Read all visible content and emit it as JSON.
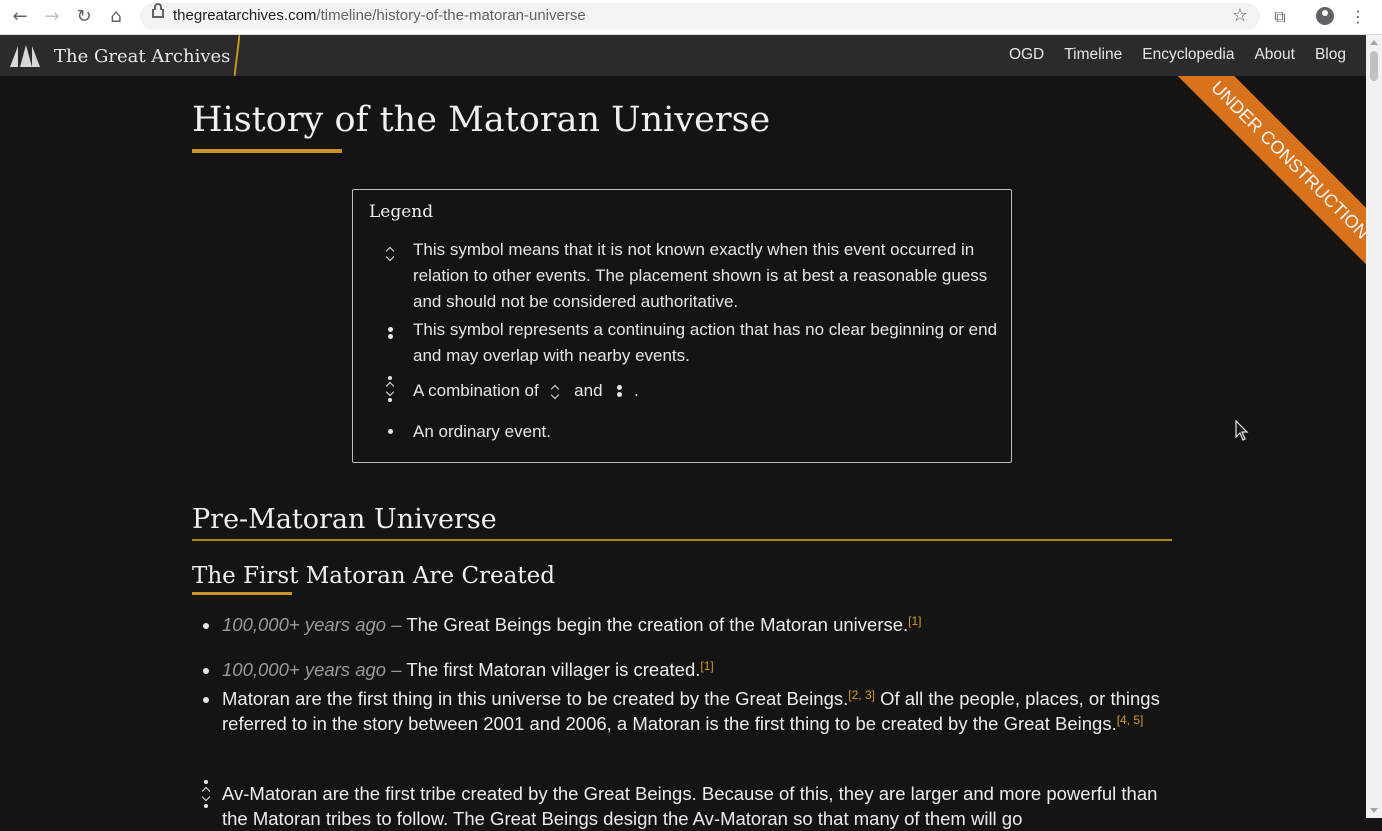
{
  "browser": {
    "url_domain": "thegreatarchives.com",
    "url_path": "/timeline/history-of-the-matoran-universe"
  },
  "site": {
    "brand": "The Great Archives",
    "nav": [
      "OGD",
      "Timeline",
      "Encyclopedia",
      "About",
      "Blog"
    ]
  },
  "ribbon": "UNDER CONSTRUCTION",
  "page": {
    "title": "History of the Matoran Universe"
  },
  "legend": {
    "title": "Legend",
    "items": [
      {
        "symbol": "uncertain-placement-icon",
        "text": "This symbol means that it is not known exactly when this event occurred in relation to other events. The placement shown is at best a reasonable guess and should not be considered authoritative."
      },
      {
        "symbol": "continuing-action-icon",
        "text": "This symbol represents a continuing action that has no clear beginning or end and may overlap with nearby events."
      },
      {
        "symbol": "combined-icon",
        "text_before": "A combination of",
        "text_mid": "and",
        "text_after": "."
      },
      {
        "symbol": "ordinary-event-icon",
        "text": "An ordinary event."
      }
    ]
  },
  "section": {
    "heading": "Pre-Matoran Universe",
    "subheading": "The First Matoran Are Created",
    "events": [
      {
        "date": "100,000+ years ago –",
        "text": "The Great Beings begin the creation of the Matoran universe.",
        "refs": "[1]"
      },
      {
        "date": "100,000+ years ago –",
        "text": "The first Matoran villager is created.",
        "refs": "[1]"
      },
      {
        "text": "Matoran are the first thing in this universe to be created by the Great Beings.",
        "refs": "[2, 3]",
        "text2": "Of all the people, places, or things referred to in the story between 2001 and 2006, a Matoran is the first thing to be created by the Great Beings.",
        "refs2": "[4, 5]"
      },
      {
        "text": "Av-Matoran are the first tribe created by the Great Beings. Because of this, they are larger and more powerful than the Matoran tribes to follow. The Great Beings design the Av-Matoran so that many of them will go"
      }
    ]
  }
}
